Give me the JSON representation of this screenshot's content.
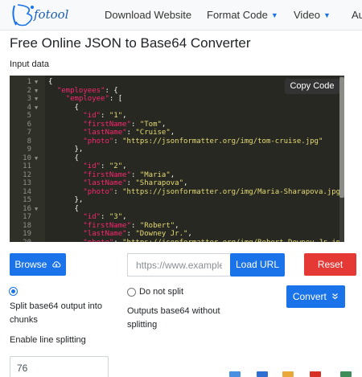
{
  "nav": {
    "brand": "fotool",
    "links": [
      {
        "label": "Download Website",
        "dropdown": false
      },
      {
        "label": "Format Code",
        "dropdown": true
      },
      {
        "label": "Video",
        "dropdown": true
      },
      {
        "label": "Au",
        "dropdown": false
      }
    ]
  },
  "page": {
    "title": "Free Online JSON to Base64 Converter",
    "input_label": "Input data"
  },
  "editor": {
    "copy_label": "Copy Code",
    "lines": [
      {
        "n": "1",
        "fold": true
      },
      {
        "n": "2",
        "fold": true
      },
      {
        "n": "3",
        "fold": true
      },
      {
        "n": "4",
        "fold": true
      },
      {
        "n": "5"
      },
      {
        "n": "6"
      },
      {
        "n": "7"
      },
      {
        "n": "8"
      },
      {
        "n": "9"
      },
      {
        "n": "10",
        "fold": true
      },
      {
        "n": "11"
      },
      {
        "n": "12"
      },
      {
        "n": "13"
      },
      {
        "n": "14"
      },
      {
        "n": "15"
      },
      {
        "n": "16",
        "fold": true
      },
      {
        "n": "17"
      },
      {
        "n": "18"
      },
      {
        "n": "19"
      },
      {
        "n": "20"
      }
    ],
    "tokens": {
      "employees": "\"employees\"",
      "employee": "\"employee\"",
      "id": "\"id\"",
      "firstName": "\"firstName\"",
      "lastName": "\"lastName\"",
      "photo": "\"photo\"",
      "v_id1": "\"1\"",
      "v_fn1": "\"Tom\"",
      "v_ln1": "\"Cruise\"",
      "v_ph1": "\"https://jsonformatter.org/img/tom-cruise.jpg\"",
      "v_id2": "\"2\"",
      "v_fn2": "\"Maria\"",
      "v_ln2": "\"Sharapova\"",
      "v_ph2": "\"https://jsonformatter.org/img/Maria-Sharapova.jpg\"",
      "v_id3": "\"3\"",
      "v_fn3": "\"Robert\"",
      "v_ln3": "\"Downey Jr.\"",
      "v_ph3": "\"https://jsonformatter.org/img/Robert-Downey-Jr.jpg\""
    }
  },
  "controls": {
    "browse_label": "Browse",
    "url_placeholder": "https://www.example.com",
    "load_url_label": "Load URL",
    "reset_label": "Reset",
    "convert_label": "Convert",
    "split_chunks_label": "Split base64 output into chunks",
    "no_split_label": "Do not split",
    "no_split_desc": "Outputs base64 without splitting",
    "enable_line_splitting_label": "Enable line splitting",
    "line_length_value": "76",
    "selected_option": "split"
  },
  "colors": {
    "primary": "#1a73e8",
    "danger": "#e53935",
    "editor_bg": "#272822"
  }
}
